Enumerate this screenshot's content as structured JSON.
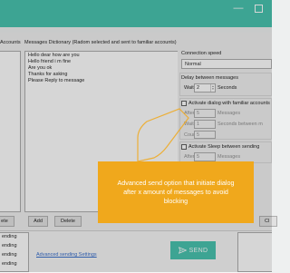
{
  "window": {
    "minimize_glyph": "—",
    "accent_color": "#3bbfaa"
  },
  "left": {
    "accounts_label": "Accounts",
    "delete_label": "ete"
  },
  "messages": {
    "title": "Messages Dictionary  (Radom selected and sent to familiar accounts)",
    "lines": [
      "Hello dear how are you",
      "Hello friend i m fine",
      "Are you ok",
      "Thanks for asking",
      "Please Reply to message"
    ],
    "add_label": "Add",
    "delete_label": "Delete"
  },
  "settings": {
    "connection_speed_label": "Connection speed",
    "connection_speed_value": "Normal",
    "delay_label": "Delay between messages",
    "wait_label": "Wait",
    "wait_value": "2",
    "seconds_label": "Seconds",
    "activate_dialog_label": "Activate dialog with familiar accounts",
    "after_label": "After",
    "after_value": "5",
    "messages_label": "Messages",
    "wait2_label": "Wait",
    "wait2_value": "1",
    "seconds_between_label": "Seconds between m",
    "count_label": "Count",
    "count_value": "5",
    "activate_sleep_label": "Activate Sleep between sending",
    "after2_label": "After",
    "after2_value": "5",
    "messages2_label": "Messages",
    "close_label": "Cl"
  },
  "bottom": {
    "list_items": [
      "ending",
      "ending",
      "ending",
      "ending"
    ],
    "advanced_link": "Advanced sending Settings",
    "send_label": "SEND",
    "send_icon": "paper-plane-icon"
  },
  "tooltip": {
    "text": "Advanced send option that initiate dialog after x amount of messages to avoid blocking",
    "color": "#f0a81c"
  }
}
